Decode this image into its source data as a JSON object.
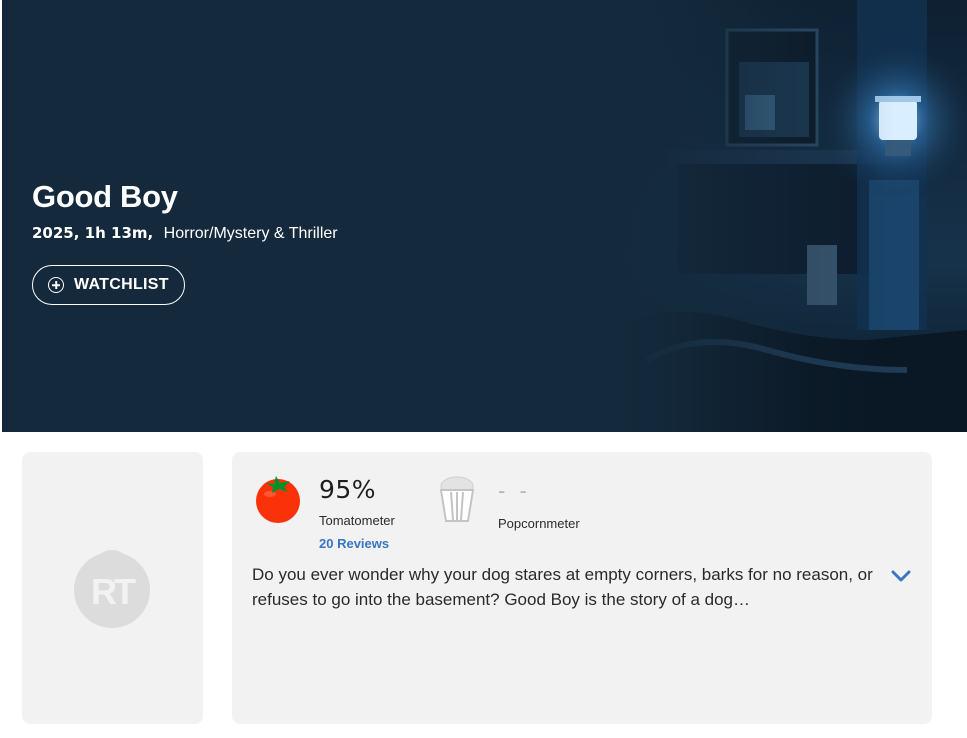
{
  "movie": {
    "title": "Good Boy",
    "year_runtime": "2025, 1h 13m,",
    "genre": "Horror/Mystery & Thriller",
    "watchlist_label": "WATCHLIST"
  },
  "scores": {
    "tomatometer_value": "95%",
    "tomatometer_label": "Tomatometer",
    "reviews_link": "20 Reviews",
    "popcornmeter_value": "- -",
    "popcornmeter_label": "Popcornmeter"
  },
  "synopsis": "Do you ever wonder why your dog stares at empty corners, barks for no reason, or refuses to go into the basement? Good Boy is the story of a dog…",
  "poster": {
    "logo_text": "RT"
  },
  "icons": {
    "watchlist": "plus-circle-icon",
    "tomato": "tomato-icon",
    "popcorn": "empty-popcorn-bucket-icon",
    "expand": "chevron-down-icon"
  },
  "colors": {
    "hero_bg": "#142a3c",
    "card_bg": "#f2f2f2",
    "link_blue": "#3a75c4",
    "tomato_red": "#fa320a"
  }
}
